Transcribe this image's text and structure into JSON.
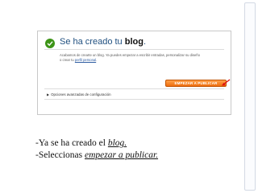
{
  "screenshot": {
    "heading_prefix": "Se ha creado tu ",
    "heading_bold": "blog",
    "heading_suffix": ".",
    "description_main": "Acabamos de crearte un blog. Ya puedes empezar a escribir entradas, personalizar su diseño",
    "description_second_prefix": "o crear tu ",
    "description_link": "perfil personal",
    "description_second_suffix": ".",
    "publish_button_label": "EMPEZAR A PUBLICAR",
    "options_label": "Opciones avanzadas de configuración"
  },
  "captions": {
    "line1_prefix": "-Ya se ha creado el ",
    "line1_em": "blog.",
    "line2_prefix": "-Seleccionas ",
    "line2_em": "empezar a publicar."
  },
  "colors": {
    "accent_orange": "#ee6e10",
    "check_green": "#3d9417",
    "arrow_red": "#d11"
  },
  "icons": [
    "check-icon",
    "red-arrow-icon",
    "triangle-right-icon"
  ]
}
